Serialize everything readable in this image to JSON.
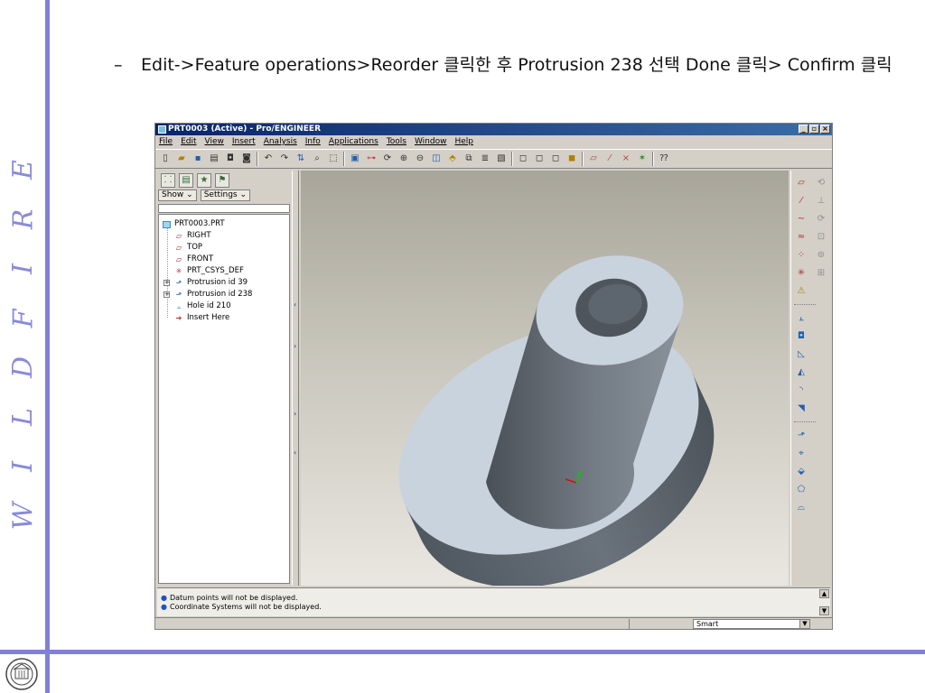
{
  "slide": {
    "side_letters": [
      "W",
      "I",
      "L",
      "D",
      "F",
      "I",
      "R",
      "E"
    ],
    "bullet_dash": "–",
    "bullet_text": "Edit->Feature operations>Reorder 클릭한 후 Protrusion 238 선택 Done 클릭> Confirm 클릭",
    "accent_color": "#8080d8"
  },
  "window": {
    "title": "PRT0003 (Active) - Pro/ENGINEER",
    "buttons": {
      "minimize": "_",
      "restore": "▫",
      "close": "×"
    },
    "menu": [
      "File",
      "Edit",
      "View",
      "Insert",
      "Analysis",
      "Info",
      "Applications",
      "Tools",
      "Window",
      "Help"
    ]
  },
  "navigator": {
    "show_label": "Show ⌄",
    "settings_label": "Settings ⌄",
    "tree": [
      {
        "label": "PRT0003.PRT",
        "icon": "part-icon"
      },
      {
        "label": "RIGHT",
        "icon": "datum-plane-icon"
      },
      {
        "label": "TOP",
        "icon": "datum-plane-icon"
      },
      {
        "label": "FRONT",
        "icon": "datum-plane-icon"
      },
      {
        "label": "PRT_CSYS_DEF",
        "icon": "csys-icon"
      },
      {
        "label": "Protrusion id 39",
        "icon": "protrusion-icon"
      },
      {
        "label": "Protrusion id 238",
        "icon": "protrusion-icon"
      },
      {
        "label": "Hole id 210",
        "icon": "hole-icon"
      },
      {
        "label": "Insert Here",
        "icon": "insert-here-arrow-icon"
      }
    ]
  },
  "messages": [
    "Datum points will not be displayed.",
    "Coordinate Systems will not be displayed."
  ],
  "status": {
    "filter_value": "Smart"
  },
  "model": {
    "face_color": "#c9d3de",
    "side_color": "#5c646d"
  }
}
